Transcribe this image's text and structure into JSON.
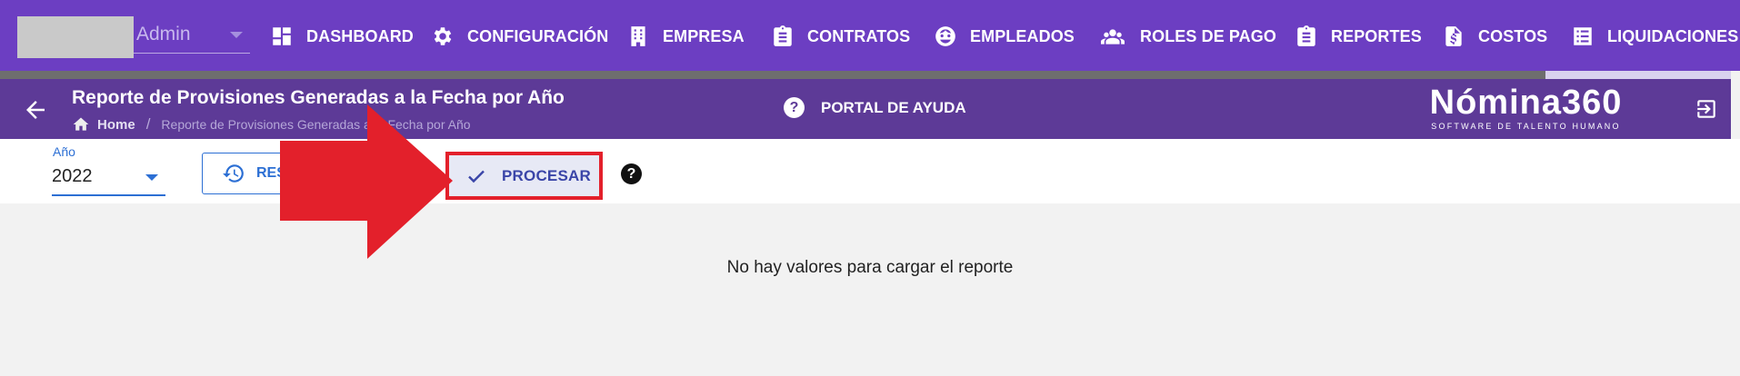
{
  "company_select": {
    "value": "Admin"
  },
  "nav": {
    "items": [
      {
        "label": "DASHBOARD",
        "icon": "dashboard-icon"
      },
      {
        "label": "CONFIGURACIÓN",
        "icon": "gear-icon"
      },
      {
        "label": "EMPRESA",
        "icon": "building-icon"
      },
      {
        "label": "CONTRATOS",
        "icon": "clipboard-icon"
      },
      {
        "label": "EMPLEADOS",
        "icon": "face-icon"
      },
      {
        "label": "ROLES DE PAGO",
        "icon": "people-icon"
      },
      {
        "label": "REPORTES",
        "icon": "clipboard-icon"
      },
      {
        "label": "COSTOS",
        "icon": "invoice-dollar-icon"
      },
      {
        "label": "LIQUIDACIONES",
        "icon": "list-icon"
      }
    ],
    "active": "LIQUIDACIONES"
  },
  "header": {
    "title": "Reporte de Provisiones Generadas a la Fecha por Año",
    "breadcrumb": {
      "home": "Home",
      "current": "Reporte de Provisiones Generadas a la Fecha por Año"
    },
    "help_portal": "PORTAL DE AYUDA",
    "brand": {
      "name": "Nómina360",
      "tagline": "SOFTWARE DE TALENTO HUMANO"
    }
  },
  "toolbar": {
    "year": {
      "label": "Año",
      "value": "2022"
    },
    "reset_label": "RES",
    "process_label": "PROCESAR",
    "help_symbol": "?"
  },
  "content": {
    "empty_message": "No hay valores para cargar el reporte"
  },
  "colors": {
    "nav_bg": "#6c3ec2",
    "header_bg": "#5d3a97",
    "primary_blue": "#2c6fd4",
    "process_text": "#3a45a8",
    "annotation_red": "#e3202b"
  }
}
